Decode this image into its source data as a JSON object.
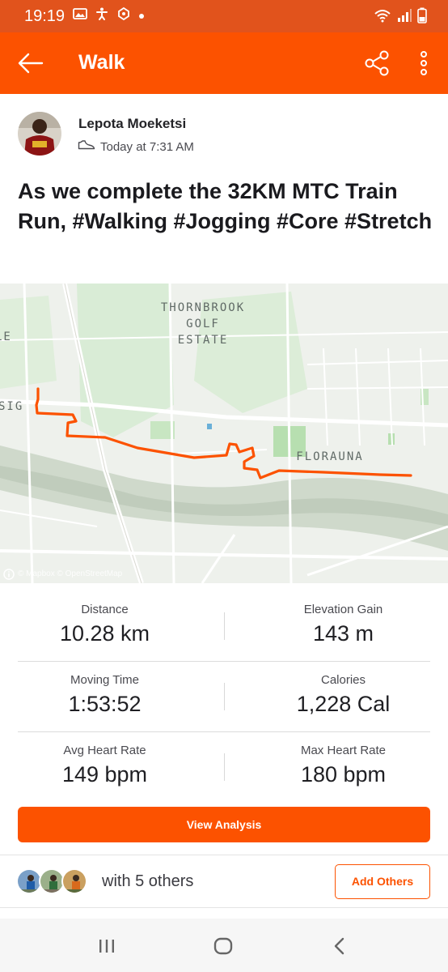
{
  "status_bar": {
    "time": "19:19",
    "left_icons": [
      "image-icon",
      "accessibility-icon",
      "sync-icon",
      "dot-icon"
    ],
    "right_icons": [
      "wifi-icon",
      "signal-icon",
      "battery-icon"
    ]
  },
  "app_bar": {
    "title": "Walk",
    "icons": [
      "back-arrow-icon",
      "share-icon",
      "more-vertical-icon"
    ]
  },
  "activity": {
    "athlete_name": "Lepota Moeketsi",
    "activity_type_icon": "shoe-icon",
    "timestamp": "Today at 7:31 AM",
    "title": "As we complete the 32KM MTC Train Run, #Walking #Jogging #Core #Stretch"
  },
  "map": {
    "labels": {
      "estate_line1": "THORNBROOK",
      "estate_line2": "GOLF",
      "estate_line3": "ESTATE",
      "suburb": "FLORAUNA",
      "edge_left_top": "LE",
      "edge_left": "SIG"
    },
    "attribution": "© Mapbox © OpenStreetMap",
    "route_color": "#fc5200"
  },
  "stats": [
    {
      "left_label": "Distance",
      "left_value": "10.28 km",
      "right_label": "Elevation Gain",
      "right_value": "143 m"
    },
    {
      "left_label": "Moving Time",
      "left_value": "1:53:52",
      "right_label": "Calories",
      "right_value": "1,228 Cal"
    },
    {
      "left_label": "Avg Heart Rate",
      "left_value": "149 bpm",
      "right_label": "Max Heart Rate",
      "right_value": "180 bpm"
    }
  ],
  "actions": {
    "view_analysis": "View Analysis",
    "with_others": "with 5 others",
    "add_others": "Add Others"
  },
  "nav": {
    "icons": [
      "recents-icon",
      "home-icon",
      "back-icon"
    ]
  },
  "colors": {
    "brand": "#fc5200",
    "status_bar": "#e1531c"
  }
}
